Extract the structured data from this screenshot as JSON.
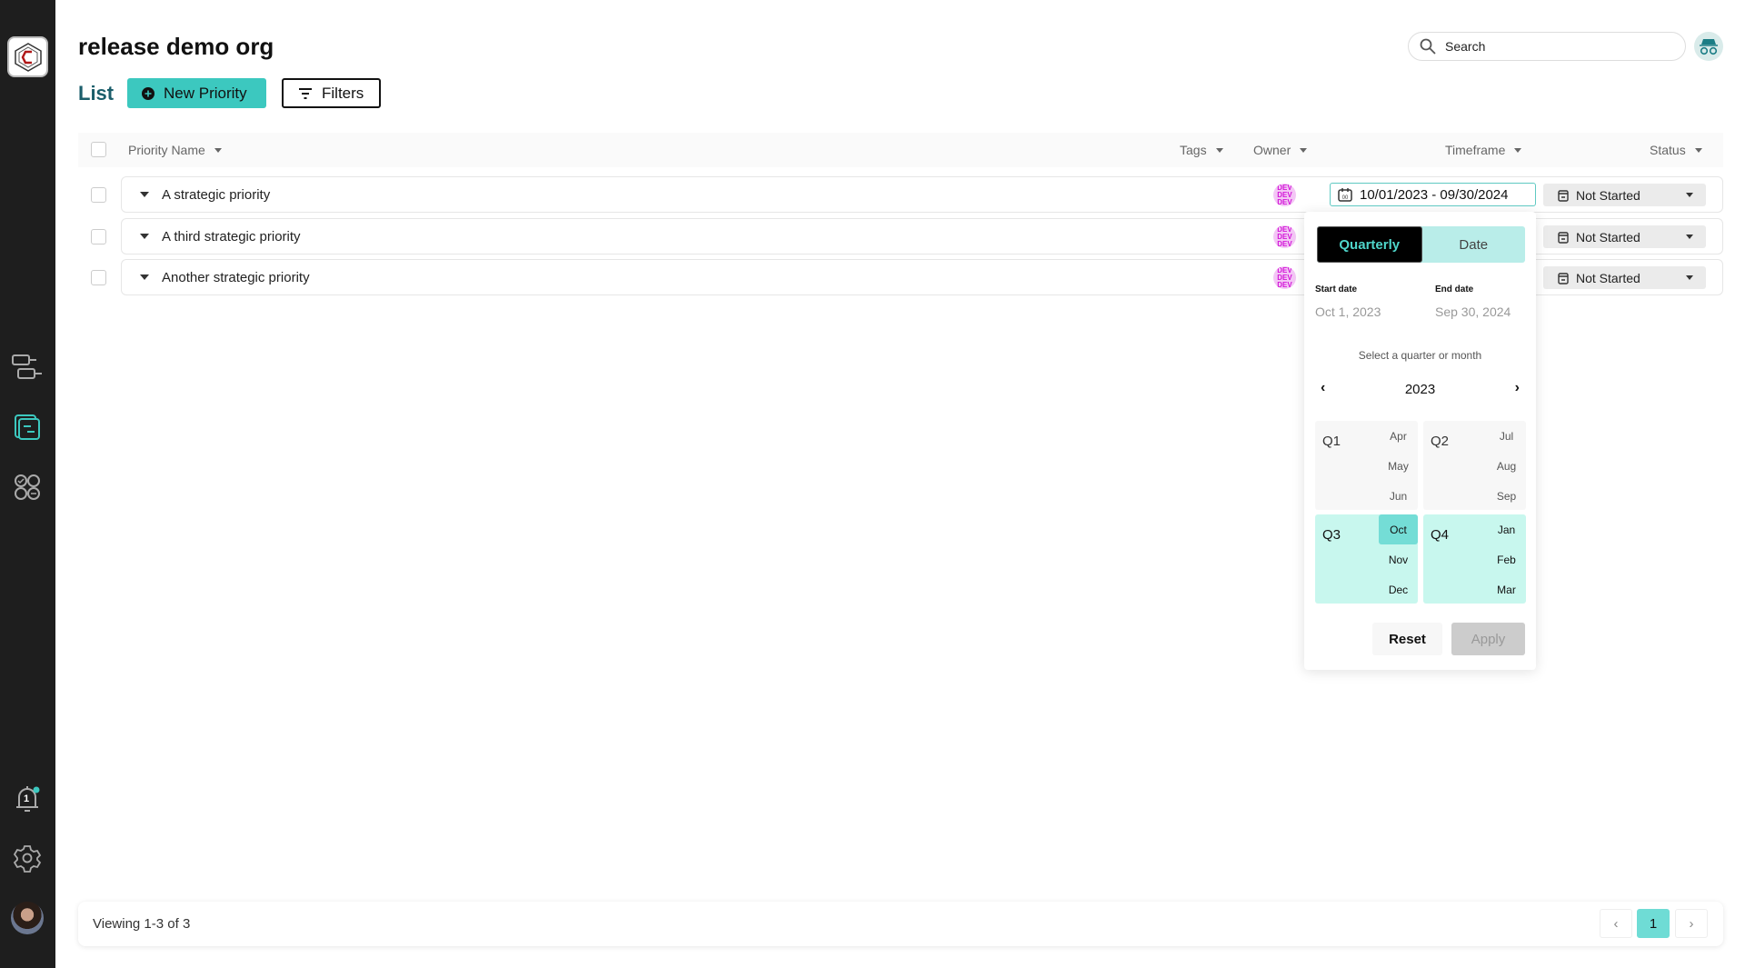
{
  "header": {
    "title": "release demo org",
    "view_label": "List",
    "new_priority_label": "New Priority",
    "filters_label": "Filters",
    "search_placeholder": "Search"
  },
  "colors": {
    "accent": "#3cc8bf",
    "sidebar": "#1e1e1e",
    "list_label": "#1b5e6b",
    "selected_quarter": "#c8f7ee",
    "selected_month": "#74ddd6"
  },
  "sidebar": {
    "notification_count": "1",
    "icons": [
      "hierarchy-icon",
      "priorities-icon",
      "apps-icon",
      "bell-icon",
      "gear-icon",
      "user-avatar"
    ]
  },
  "table": {
    "columns": [
      "Priority Name",
      "Tags",
      "Owner",
      "Timeframe",
      "Status"
    ],
    "rows": [
      {
        "name": "A strategic priority",
        "owner": "DEV",
        "timeframe": "10/01/2023 - 09/30/2024",
        "status": "Not Started"
      },
      {
        "name": "A third strategic priority",
        "owner": "DEV",
        "status": "Not Started"
      },
      {
        "name": "Another strategic priority",
        "owner": "DEV",
        "status": "Not Started"
      }
    ]
  },
  "timeframe_picker": {
    "tabs": [
      "Quarterly",
      "Date"
    ],
    "active_tab": "Quarterly",
    "start_label": "Start date",
    "start_value": "Oct 1, 2023",
    "end_label": "End date",
    "end_value": "Sep 30, 2024",
    "hint": "Select a quarter or month",
    "year": "2023",
    "quarters": [
      {
        "label": "Q1",
        "months": [
          "Apr",
          "May",
          "Jun"
        ],
        "selected": false
      },
      {
        "label": "Q2",
        "months": [
          "Jul",
          "Aug",
          "Sep"
        ],
        "selected": false
      },
      {
        "label": "Q3",
        "months": [
          "Oct",
          "Nov",
          "Dec"
        ],
        "selected": true
      },
      {
        "label": "Q4",
        "months": [
          "Jan",
          "Feb",
          "Mar"
        ],
        "selected": true
      }
    ],
    "highlighted_month": "Oct",
    "reset_label": "Reset",
    "apply_label": "Apply"
  },
  "footer": {
    "viewing": "Viewing 1-3 of 3",
    "current_page": "1"
  }
}
